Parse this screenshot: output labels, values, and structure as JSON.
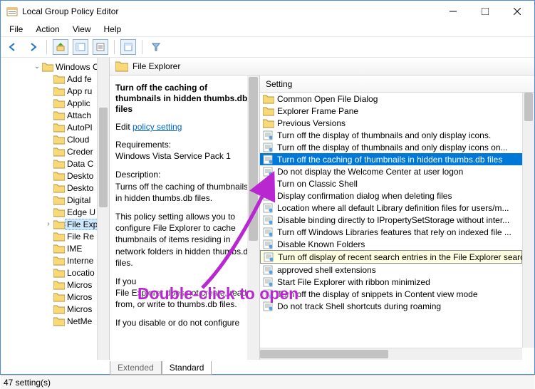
{
  "window": {
    "title": "Local Group Policy Editor"
  },
  "menu": {
    "file": "File",
    "action": "Action",
    "view": "View",
    "help": "Help"
  },
  "tree": {
    "root": "Windows C",
    "items": [
      "Add fe",
      "App ru",
      "Applic",
      "Attach",
      "AutoPl",
      "Cloud",
      "Creder",
      "Data C",
      "Deskto",
      "Deskto",
      "Digital",
      "Edge U",
      "File Exp",
      "File Re",
      "IME",
      "Interne",
      "Locatio",
      "Micros",
      "Micros",
      "Micros",
      "NetMe"
    ],
    "selectedIndex": 12,
    "expandable": [
      12
    ]
  },
  "header": {
    "title": "File Explorer"
  },
  "description": {
    "title": "Turn off the caching of thumbnails in hidden thumbs.db files",
    "editPrefix": "Edit ",
    "editLink": "policy setting",
    "reqLabel": "Requirements:",
    "reqText": "Windows Vista Service Pack 1",
    "descLabel": "Description:",
    "descText": "Turns off the caching of thumbnails in hidden thumbs.db files.",
    "para2": "This policy setting allows you to configure File Explorer to cache thumbnails of items residing in network folders in hidden thumbs.db files.",
    "para3prefix": "If you",
    "para3": "File Explorer does not create, read from, or write to thumbs.db files.",
    "para4": "If you disable or do not configure"
  },
  "list": {
    "header": "Setting",
    "items": [
      {
        "type": "folder",
        "label": "Common Open File Dialog"
      },
      {
        "type": "folder",
        "label": "Explorer Frame Pane"
      },
      {
        "type": "folder",
        "label": "Previous Versions"
      },
      {
        "type": "setting",
        "label": "Turn off the display of thumbnails and only display icons."
      },
      {
        "type": "setting",
        "label": "Turn off the display of thumbnails and only display icons on..."
      },
      {
        "type": "setting",
        "label": "Turn off the caching of thumbnails in hidden thumbs.db files",
        "selected": true
      },
      {
        "type": "setting",
        "label": "Do not display the Welcome Center at user logon"
      },
      {
        "type": "setting",
        "label": "Turn on Classic Shell"
      },
      {
        "type": "setting",
        "label": "Display confirmation dialog when deleting files"
      },
      {
        "type": "setting",
        "label": "Location where all default Library definition files for users/m..."
      },
      {
        "type": "setting",
        "label": "Disable binding directly to IPropertySetStorage without inter..."
      },
      {
        "type": "setting",
        "label": "Turn off Windows Libraries features that rely on indexed file ..."
      },
      {
        "type": "setting",
        "label": "Disable Known Folders"
      },
      {
        "type": "setting",
        "label": "Turn off display of recent search entries in the File Explorer search bo",
        "tooltip": true
      },
      {
        "type": "setting",
        "label": "approved shell extensions"
      },
      {
        "type": "setting",
        "label": "Start File Explorer with ribbon minimized"
      },
      {
        "type": "setting",
        "label": "Turn off the display of snippets in Content view mode"
      },
      {
        "type": "setting",
        "label": "Do not track Shell shortcuts during roaming"
      }
    ]
  },
  "tabs": {
    "extended": "Extended",
    "standard": "Standard"
  },
  "status": {
    "text": "47 setting(s)"
  },
  "annotation": {
    "text": "Double-click to open"
  }
}
